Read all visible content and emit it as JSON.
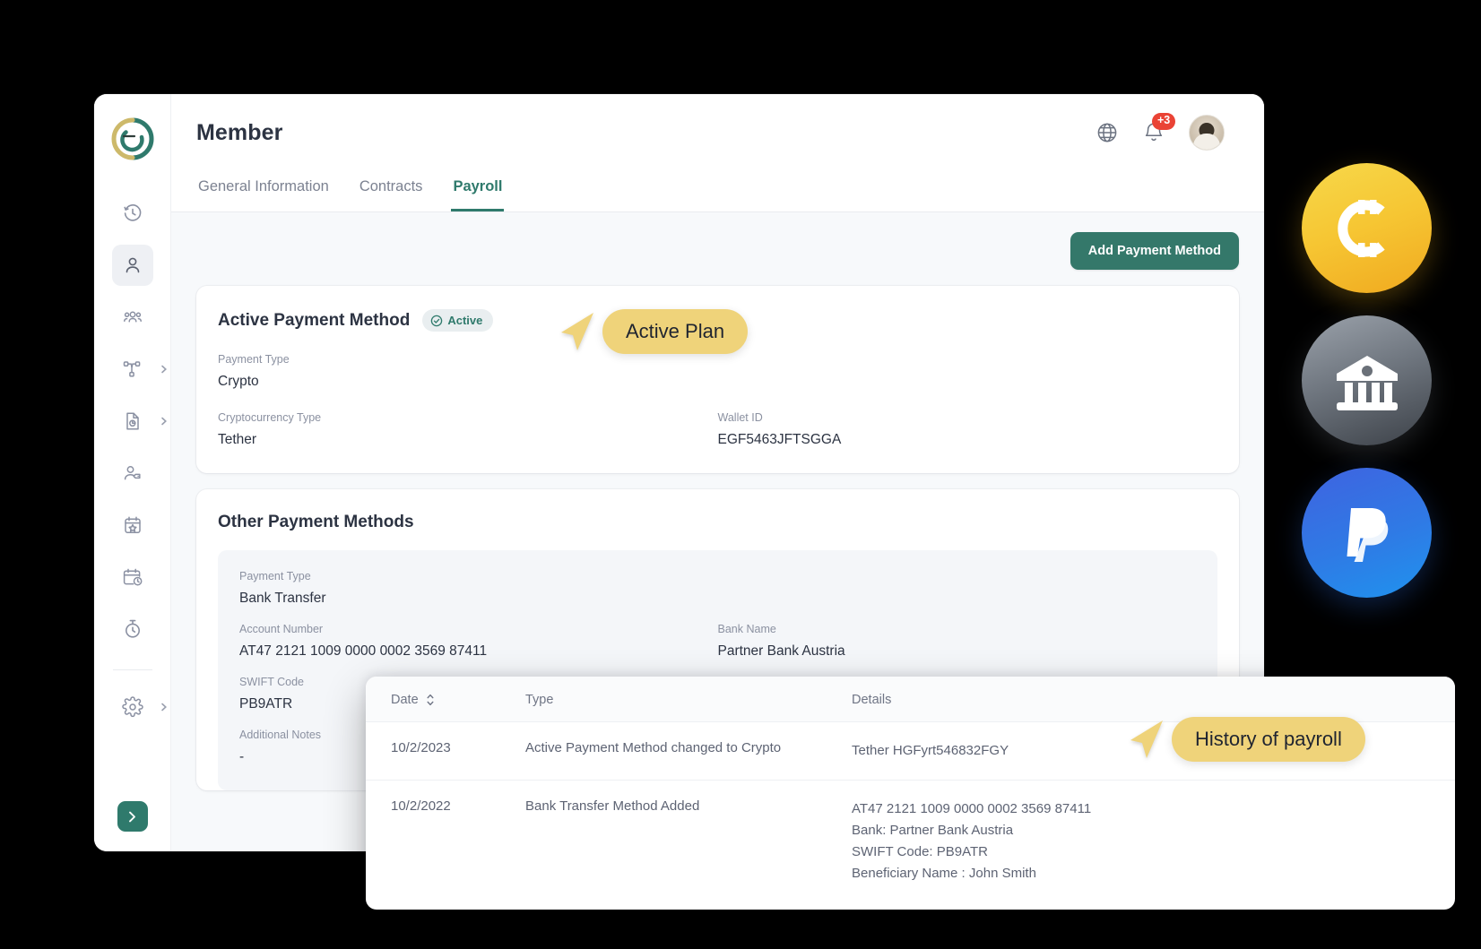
{
  "window": {
    "title": "Member"
  },
  "sidebar": {
    "logo_name": "company-logo",
    "items": [
      {
        "icon": "clock-history-icon",
        "label": "Time Tracking",
        "active": false,
        "chevron": false
      },
      {
        "icon": "user-icon",
        "label": "Member",
        "active": true,
        "chevron": false
      },
      {
        "icon": "people-group-icon",
        "label": "Teams",
        "active": false,
        "chevron": false
      },
      {
        "icon": "org-chart-icon",
        "label": "Organization",
        "active": false,
        "chevron": true
      },
      {
        "icon": "document-report-icon",
        "label": "Reports",
        "active": false,
        "chevron": true
      },
      {
        "icon": "user-tag-icon",
        "label": "Recruitment",
        "active": false,
        "chevron": false
      },
      {
        "icon": "calendar-star-icon",
        "label": "Events",
        "active": false,
        "chevron": false
      },
      {
        "icon": "calendar-clock-icon",
        "label": "Schedule",
        "active": false,
        "chevron": false
      },
      {
        "icon": "stopwatch-icon",
        "label": "Timer",
        "active": false,
        "chevron": false
      },
      {
        "icon": "gear-icon",
        "label": "Settings",
        "active": false,
        "chevron": true
      }
    ],
    "toggle_label": "Expand sidebar"
  },
  "topbar": {
    "language_icon": "globe-icon",
    "notifications_icon": "bell-icon",
    "notification_badge": "+3",
    "avatar_name": "user-avatar"
  },
  "tabs": [
    {
      "label": "General Information",
      "active": false
    },
    {
      "label": "Contracts",
      "active": false
    },
    {
      "label": "Payroll",
      "active": true
    }
  ],
  "toolbar": {
    "add_payment_method_label": "Add Payment Method"
  },
  "active_payment_method": {
    "title": "Active Payment Method",
    "badge": "Active",
    "badge_icon": "check-circle-icon",
    "fields": [
      {
        "label": "Payment Type",
        "value": "Crypto"
      },
      {
        "label": "Cryptocurrency Type",
        "value": "Tether"
      },
      {
        "label": "Wallet ID",
        "value": "EGF5463JFTSGGA"
      }
    ]
  },
  "other_payment_methods": {
    "title": "Other Payment Methods",
    "fields": [
      {
        "label": "Payment Type",
        "value": "Bank Transfer"
      },
      {
        "label": "Account Number",
        "value": "AT47 2121 1009 0000 0002 3569 87411"
      },
      {
        "label": "Bank Name",
        "value": "Partner Bank Austria"
      },
      {
        "label": "SWIFT Code",
        "value": "PB9ATR"
      },
      {
        "label": "Additional Notes",
        "value": "-"
      }
    ]
  },
  "history_panel": {
    "columns": [
      {
        "label": "Date",
        "sort_icon": "sort-updown-icon"
      },
      {
        "label": "Type",
        "sort_icon": ""
      },
      {
        "label": "Details",
        "sort_icon": ""
      }
    ],
    "rows": [
      {
        "date": "10/2/2023",
        "type": "Active Payment Method changed to Crypto",
        "details": [
          "Tether  HGFyrt546832FGY"
        ]
      },
      {
        "date": "10/2/2022",
        "type": "Bank Transfer Method Added",
        "details": [
          "AT47 2121 1009 0000 0002 3569 87411",
          "Bank: Partner Bank Austria",
          "SWIFT Code:  PB9ATR",
          "Beneficiary Name : John Smith"
        ]
      }
    ]
  },
  "callouts": [
    {
      "name": "active-plan",
      "text": "Active Plan"
    },
    {
      "name": "history-of-payroll",
      "text": "History of payroll"
    }
  ],
  "floating_badges": [
    {
      "name": "crypto-coin-badge",
      "icon": "crypto-coin-icon",
      "color": "#f6c633"
    },
    {
      "name": "bank-badge",
      "icon": "bank-building-icon",
      "color": "#707780"
    },
    {
      "name": "paypal-badge",
      "icon": "paypal-icon",
      "color": "#2f7ae5"
    }
  ],
  "colors": {
    "brand_green": "#2f7a6c",
    "accent_yellow": "#efd37a",
    "notification_red": "#ea4335",
    "content_bg": "#f7f9fb"
  }
}
